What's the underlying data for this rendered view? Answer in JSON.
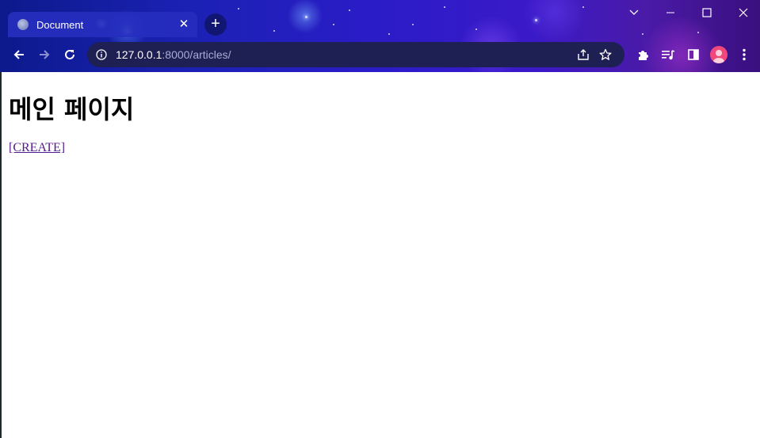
{
  "browser": {
    "tab": {
      "title": "Document",
      "favicon": "globe-icon",
      "close_glyph": "✕"
    },
    "new_tab_glyph": "+",
    "address_bar": {
      "host": "127.0.0.1",
      "path": ":8000/articles/",
      "site_info_icon": "info-icon"
    },
    "window_controls": [
      "chevron-down-icon",
      "minimize-icon",
      "maximize-icon",
      "close-icon"
    ],
    "toolbar_icons": [
      "extensions-icon",
      "reading-list-icon",
      "side-panel-icon",
      "profile-avatar",
      "more-menu-icon"
    ],
    "accent_color": "#1b21b4"
  },
  "page": {
    "heading": "메인 페이지",
    "create_link": "[CREATE]",
    "link_color": "#551a8b"
  }
}
